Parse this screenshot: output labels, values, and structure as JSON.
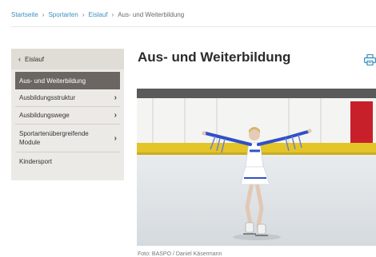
{
  "breadcrumb": {
    "items": [
      "Startseite",
      "Sportarten",
      "Eislauf"
    ],
    "separator": "›",
    "current": "Aus- und Weiterbildung"
  },
  "sidebar": {
    "back_chevron": "‹",
    "back_label": "Eislauf",
    "active_label": "Aus- und Weiterbildung",
    "items": [
      {
        "label": "Ausbildungsstruktur",
        "arrow": "›"
      },
      {
        "label": "Ausbildungswege",
        "arrow": "›"
      },
      {
        "label": "Sportartenübergreifende Module",
        "arrow": "›"
      },
      {
        "label": "Kindersport",
        "arrow": ""
      }
    ]
  },
  "page": {
    "title": "Aus- und Weiterbildung",
    "print_icon": "printer-icon",
    "caption": "Foto: BASPO / Daniel Käsermann"
  },
  "colors": {
    "link": "#3a8fbf",
    "sidebar_bg": "#eceae6",
    "sidebar_active": "#6b6662",
    "print_icon": "#3a8fbf"
  }
}
